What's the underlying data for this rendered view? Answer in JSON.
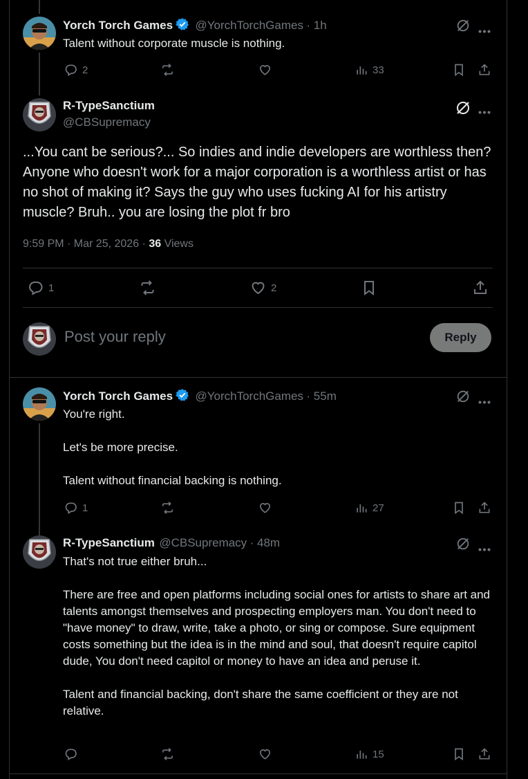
{
  "post1": {
    "name": "Yorch Torch Games",
    "handle": "@YorchTorchGames",
    "time": "· 1h",
    "text": "Talent without corporate muscle is nothing.",
    "replies": "2",
    "views": "33"
  },
  "main": {
    "name": "R-TypeSanctium",
    "handle": "@CBSupremacy",
    "text": "...You cant be serious?... So indies and indie developers are worthless then? Anyone who doesn't work for a major corporation is a worthless artist or has no shot of making it? Says the guy who uses fucking AI for his artistry muscle? Bruh.. you are losing the plot fr bro",
    "timestamp": "9:59 PM · Mar 25, 2026 ·",
    "views_count": "36",
    "views_label": "Views",
    "replies": "1",
    "likes": "2"
  },
  "composer": {
    "placeholder": "Post your reply",
    "button": "Reply"
  },
  "post2": {
    "name": "Yorch Torch Games",
    "handle": "@YorchTorchGames",
    "time": "· 55m",
    "text": "You're right.\n\nLet's be more precise.\n\nTalent without financial backing is nothing.",
    "replies": "1",
    "views": "27"
  },
  "post3": {
    "name": "R-TypeSanctium",
    "handle": "@CBSupremacy",
    "time": "· 48m",
    "text": "That's not true either bruh...\n\nThere are free and open platforms including social ones for artists to share art and talents amongst themselves and prospecting employers man. You don't need to \"have money\" to draw, write, take a photo, or sing or compose. Sure equipment costs something but the idea is in the mind and soul, that doesn't require capitol dude, You don't need capitol or money to have an idea and peruse it.\n\nTalent and financial backing, don't share the same coefficient or they are not relative.",
    "views": "15"
  },
  "colors": {
    "background": "#000000",
    "text": "#e7e9ea",
    "secondary": "#71767b",
    "verified": "#1d9bf0",
    "border": "#2f3336"
  }
}
